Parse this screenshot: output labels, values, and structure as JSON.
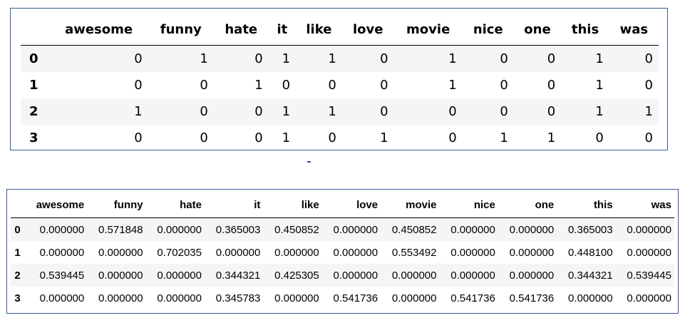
{
  "count_table": {
    "columns": [
      "",
      "awesome",
      "funny",
      "hate",
      "it",
      "like",
      "love",
      "movie",
      "nice",
      "one",
      "this",
      "was"
    ],
    "rows": [
      {
        "index": "0",
        "values": [
          "0",
          "1",
          "0",
          "1",
          "1",
          "0",
          "1",
          "0",
          "0",
          "1",
          "0"
        ]
      },
      {
        "index": "1",
        "values": [
          "0",
          "0",
          "1",
          "0",
          "0",
          "0",
          "1",
          "0",
          "0",
          "1",
          "0"
        ]
      },
      {
        "index": "2",
        "values": [
          "1",
          "0",
          "0",
          "1",
          "1",
          "0",
          "0",
          "0",
          "0",
          "1",
          "1"
        ]
      },
      {
        "index": "3",
        "values": [
          "0",
          "0",
          "0",
          "1",
          "0",
          "1",
          "0",
          "1",
          "1",
          "0",
          "0"
        ]
      }
    ]
  },
  "tfidf_table": {
    "columns": [
      "",
      "awesome",
      "funny",
      "hate",
      "it",
      "like",
      "love",
      "movie",
      "nice",
      "one",
      "this",
      "was"
    ],
    "rows": [
      {
        "index": "0",
        "values": [
          "0.000000",
          "0.571848",
          "0.000000",
          "0.365003",
          "0.450852",
          "0.000000",
          "0.450852",
          "0.000000",
          "0.000000",
          "0.365003",
          "0.000000"
        ]
      },
      {
        "index": "1",
        "values": [
          "0.000000",
          "0.000000",
          "0.702035",
          "0.000000",
          "0.000000",
          "0.000000",
          "0.553492",
          "0.000000",
          "0.000000",
          "0.448100",
          "0.000000"
        ]
      },
      {
        "index": "2",
        "values": [
          "0.539445",
          "0.000000",
          "0.000000",
          "0.344321",
          "0.425305",
          "0.000000",
          "0.000000",
          "0.000000",
          "0.000000",
          "0.344321",
          "0.539445"
        ]
      },
      {
        "index": "3",
        "values": [
          "0.000000",
          "0.000000",
          "0.000000",
          "0.345783",
          "0.000000",
          "0.541736",
          "0.000000",
          "0.541736",
          "0.541736",
          "0.000000",
          "0.000000"
        ]
      }
    ]
  },
  "colors": {
    "panel_border": "#3a5a9a",
    "stripe": "#f5f5f5",
    "mark": "#2a4fb0"
  }
}
